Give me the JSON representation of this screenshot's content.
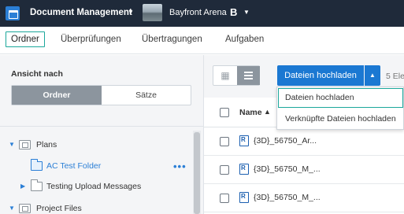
{
  "header": {
    "product": "Document Management",
    "project": "Bayfront Arena",
    "bim_badge": "B"
  },
  "tabs": [
    {
      "label": "Ordner",
      "active": true
    },
    {
      "label": "Überprüfungen"
    },
    {
      "label": "Übertragungen"
    },
    {
      "label": "Aufgaben"
    }
  ],
  "left": {
    "view_label": "Ansicht nach",
    "seg_folders": "Ordner",
    "seg_sets": "Sätze",
    "tree": [
      {
        "label": "Plans",
        "icon": "stacked-folder-icon"
      },
      {
        "label": "AC Test Folder",
        "icon": "folder-icon",
        "selected": true,
        "more": "•••"
      },
      {
        "label": "Testing Upload Messages",
        "icon": "folder-icon"
      },
      {
        "label": "Project Files",
        "icon": "stacked-folder-icon"
      }
    ]
  },
  "toolbar": {
    "upload_label": "Dateien hochladen",
    "count_text": "5 Ele"
  },
  "table": {
    "col_name": "Name",
    "rows": [
      "{3D}_56750_Ar...",
      "{3D}_56750_M_...",
      "{3D}_56750_M_..."
    ]
  },
  "dropdown": {
    "items": [
      "Dateien hochladen",
      "Verknüpfte Dateien hochladen"
    ]
  },
  "colors": {
    "topbar": "#1f2a3a",
    "accent_blue": "#1b78d2",
    "teal_highlight": "#1ba79b"
  }
}
